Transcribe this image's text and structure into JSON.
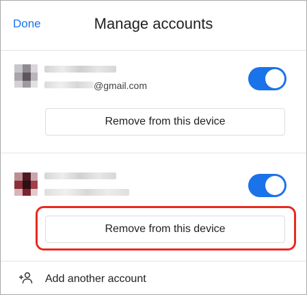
{
  "header": {
    "done_label": "Done",
    "title": "Manage accounts"
  },
  "accounts": [
    {
      "email_suffix": "@gmail.com",
      "sync_enabled": true,
      "remove_label": "Remove from this device"
    },
    {
      "email_suffix": "",
      "sync_enabled": true,
      "remove_label": "Remove from this device",
      "highlighted": true
    }
  ],
  "footer": {
    "add_account_label": "Add another account",
    "add_account_icon": "person-add-icon"
  },
  "colors": {
    "accent": "#1a73e8",
    "highlight": "#e8281e",
    "divider": "#e3e3e3"
  }
}
